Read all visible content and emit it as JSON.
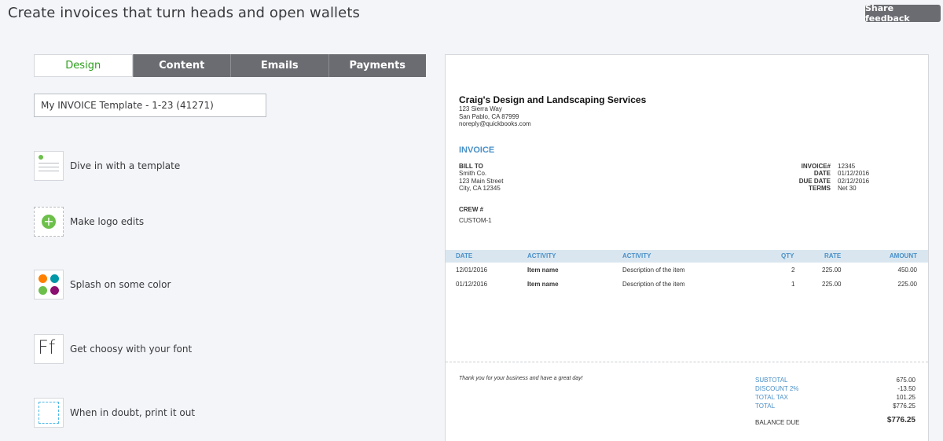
{
  "header": {
    "title": "Create invoices that turn heads and open wallets",
    "feedback_label": "Share feedback"
  },
  "tabs": [
    {
      "label": "Design",
      "active": true
    },
    {
      "label": "Content",
      "active": false
    },
    {
      "label": "Emails",
      "active": false
    },
    {
      "label": "Payments",
      "active": false
    }
  ],
  "template_name": {
    "value": "My INVOICE Template - 1-23 (41271)"
  },
  "options": [
    {
      "label": "Dive in with a template",
      "icon": "template-icon"
    },
    {
      "label": "Make logo edits",
      "icon": "logo-add-icon"
    },
    {
      "label": "Splash on some color",
      "icon": "color-palette-icon"
    },
    {
      "label": "Get choosy with your font",
      "icon": "font-icon"
    },
    {
      "label": "When in doubt, print it out",
      "icon": "print-margin-icon"
    }
  ],
  "colors": {
    "accent_green": "#2ca01c",
    "invoice_blue": "#4a90c8",
    "tab_gray": "#6b6c72",
    "palette": [
      "#ff8000",
      "#0097a7",
      "#6cc04a",
      "#8b0f6e"
    ]
  },
  "invoice": {
    "company": {
      "name": "Craig's Design and Landscaping Services",
      "address1": "123 Sierra Way",
      "address2": "San Pablo, CA 87999",
      "email": "noreply@quickbooks.com"
    },
    "title": "INVOICE",
    "bill_to": {
      "label": "BILL TO",
      "line1": "Smith Co.",
      "line2": "123 Main Street",
      "line3": "City, CA 12345"
    },
    "meta": {
      "invoice_label": "INVOICE#",
      "invoice_value": "12345",
      "date_label": "DATE",
      "date_value": "01/12/2016",
      "due_label": "DUE DATE",
      "due_value": "02/12/2016",
      "terms_label": "TERMS",
      "terms_value": "Net 30"
    },
    "crew": {
      "label": "CREW #",
      "value": "CUSTOM-1"
    },
    "columns": {
      "date": "DATE",
      "activity": "ACTIVITY",
      "activity2": "ACTIVITY",
      "qty": "QTY",
      "rate": "RATE",
      "amount": "AMOUNT"
    },
    "rows": [
      {
        "date": "12/01/2016",
        "item": "Item name",
        "desc": "Description of the item",
        "qty": "2",
        "rate": "225.00",
        "amount": "450.00"
      },
      {
        "date": "01/12/2016",
        "item": "Item name",
        "desc": "Description of the item",
        "qty": "1",
        "rate": "225.00",
        "amount": "225.00"
      }
    ],
    "note": "Thank you for your business and have a great day!",
    "totals": {
      "subtotal_label": "SUBTOTAL",
      "subtotal_value": "675.00",
      "discount_label": "DISCOUNT 2%",
      "discount_value": "-13.50",
      "tax_label": "TOTAL TAX",
      "tax_value": "101.25",
      "total_label": "TOTAL",
      "total_value": "$776.25",
      "balance_label": "BALANCE DUE",
      "balance_value": "$776.25"
    }
  }
}
